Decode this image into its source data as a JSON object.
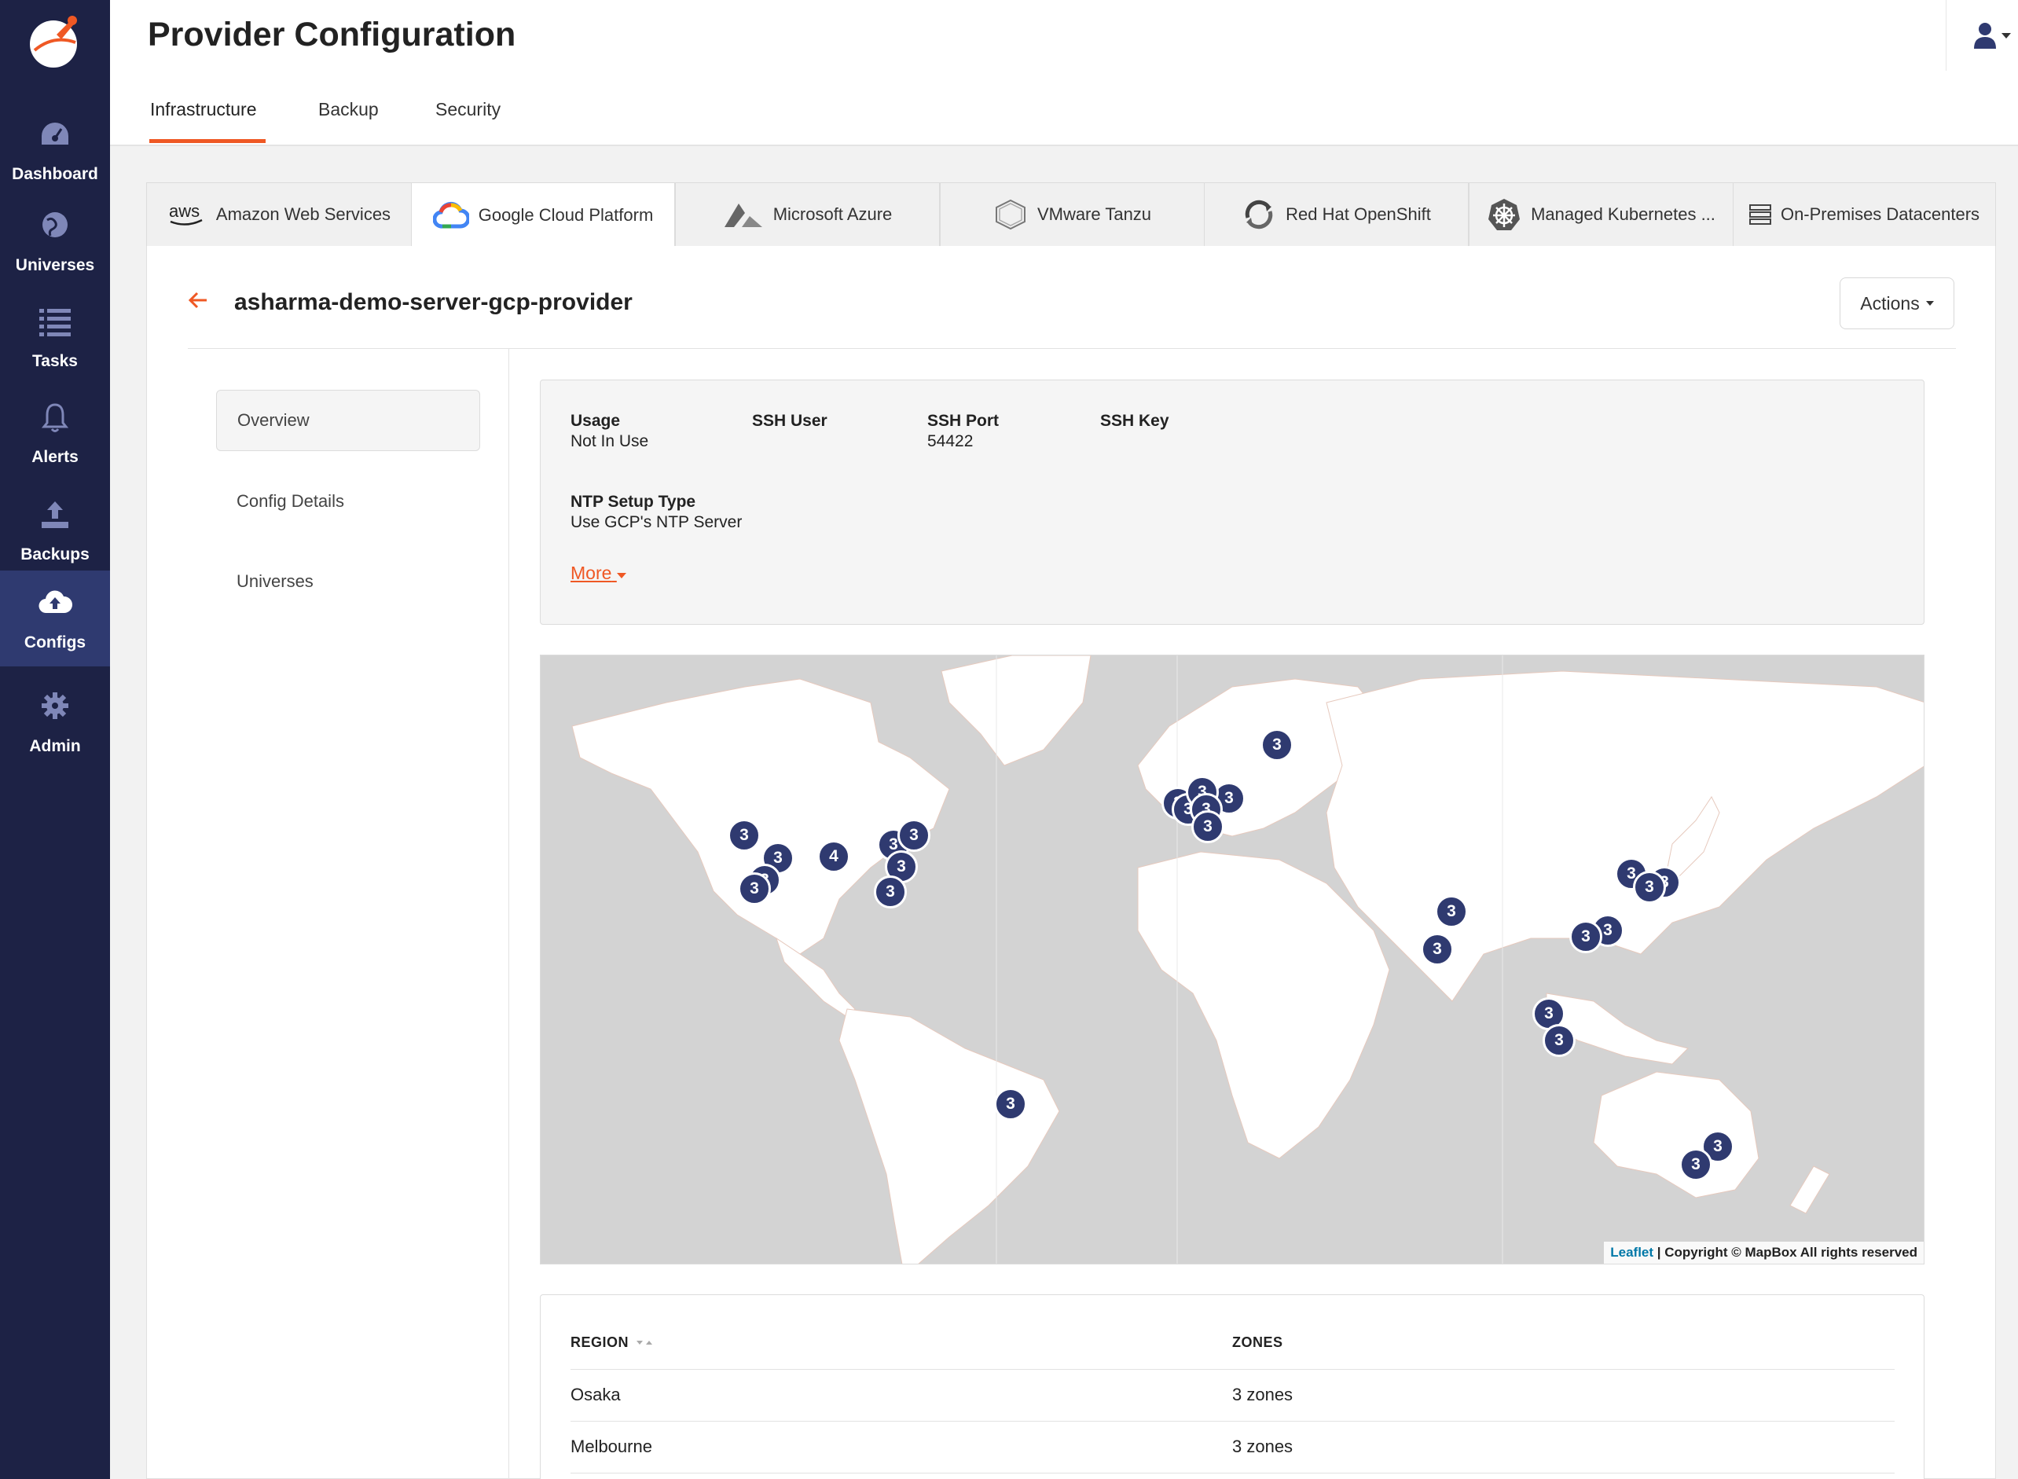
{
  "sidebar": {
    "items": [
      {
        "label": "Dashboard",
        "icon": "dashboard-icon"
      },
      {
        "label": "Universes",
        "icon": "globe-icon"
      },
      {
        "label": "Tasks",
        "icon": "list-icon"
      },
      {
        "label": "Alerts",
        "icon": "bell-icon"
      },
      {
        "label": "Backups",
        "icon": "upload-icon"
      },
      {
        "label": "Configs",
        "icon": "cloud-upload-icon",
        "active": true
      },
      {
        "label": "Admin",
        "icon": "gear-icon"
      }
    ]
  },
  "header": {
    "title": "Provider Configuration",
    "tabs": [
      {
        "label": "Infrastructure",
        "active": true
      },
      {
        "label": "Backup"
      },
      {
        "label": "Security"
      }
    ]
  },
  "provider_tabs": [
    {
      "label": "Amazon Web Services",
      "icon": "aws-icon"
    },
    {
      "label": "Google Cloud Platform",
      "icon": "gcp-icon",
      "active": true
    },
    {
      "label": "Microsoft Azure",
      "icon": "azure-icon"
    },
    {
      "label": "VMware Tanzu",
      "icon": "tanzu-icon"
    },
    {
      "label": "Red Hat OpenShift",
      "icon": "openshift-icon"
    },
    {
      "label": "Managed Kubernetes ...",
      "icon": "kubernetes-icon"
    },
    {
      "label": "On-Premises Datacenters",
      "icon": "server-icon"
    }
  ],
  "provider": {
    "name": "asharma-demo-server-gcp-provider",
    "actions_label": "Actions"
  },
  "side_tabs": [
    {
      "label": "Overview",
      "active": true
    },
    {
      "label": "Config Details"
    },
    {
      "label": "Universes"
    }
  ],
  "overview": {
    "usage_label": "Usage",
    "usage_value": "Not In Use",
    "ssh_user_label": "SSH User",
    "ssh_user_value": "",
    "ssh_port_label": "SSH Port",
    "ssh_port_value": "54422",
    "ssh_key_label": "SSH Key",
    "ssh_key_value": "",
    "ntp_label": "NTP Setup Type",
    "ntp_value": "Use GCP's NTP Server",
    "more_label": "More"
  },
  "map": {
    "markers": [
      "3",
      "3",
      "3",
      "3",
      "3",
      "3",
      "3",
      "3",
      "3",
      "4",
      "3",
      "3",
      "3",
      "3",
      "3",
      "3",
      "3",
      "3",
      "3",
      "3",
      "3",
      "3",
      "3",
      "3",
      "3",
      "3",
      "3",
      "3",
      "3",
      "3"
    ],
    "attribution_link": "Leaflet",
    "attribution_text": "| Copyright © MapBox All rights reserved"
  },
  "regions_table": {
    "columns": [
      "REGION",
      "ZONES"
    ],
    "rows": [
      {
        "region": "Osaka",
        "zones": "3 zones"
      },
      {
        "region": "Melbourne",
        "zones": "3 zones"
      }
    ]
  },
  "colors": {
    "sidebar_bg": "#1d2245",
    "accent": "#ef5824",
    "marker": "#2f3a70"
  }
}
